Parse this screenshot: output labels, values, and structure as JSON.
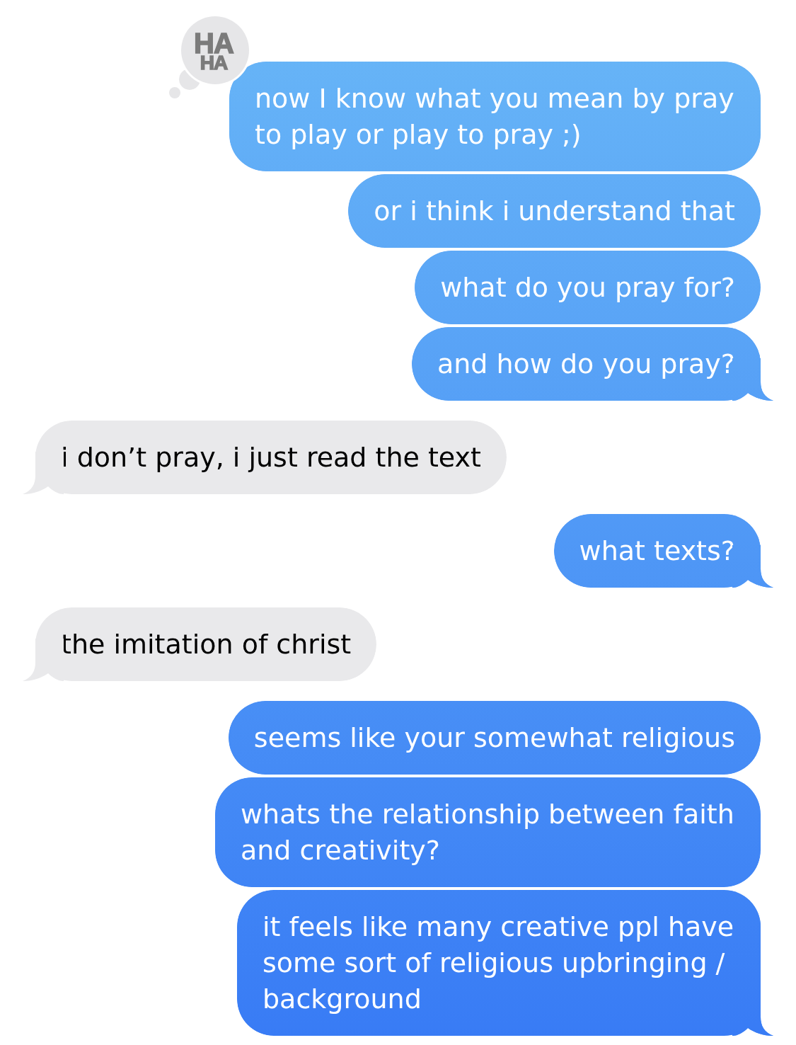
{
  "messages": [
    {
      "kind": "sent",
      "text": "now I know what you mean by pray to play or play to pray ;)",
      "tail": false,
      "reaction": {
        "label": "HA HA"
      }
    },
    {
      "kind": "sent",
      "text": "or i think i understand that",
      "tail": false
    },
    {
      "kind": "sent",
      "text": "what do you pray for?",
      "tail": false
    },
    {
      "kind": "sent",
      "text": "and how do you pray?",
      "tail": true
    },
    {
      "kind": "received",
      "text": "i don’t pray, i just read the text",
      "tail": true
    },
    {
      "kind": "sent",
      "text": "what texts?",
      "tail": true
    },
    {
      "kind": "received",
      "text": "the imitation of christ",
      "tail": true
    },
    {
      "kind": "sent",
      "text": "seems like your somewhat religious",
      "tail": false
    },
    {
      "kind": "sent",
      "text": "whats the relationship between faith and creativity?",
      "tail": false
    },
    {
      "kind": "sent",
      "text": "it feels like many creative ppl have some sort of religious upbringing / background",
      "tail": true
    }
  ]
}
